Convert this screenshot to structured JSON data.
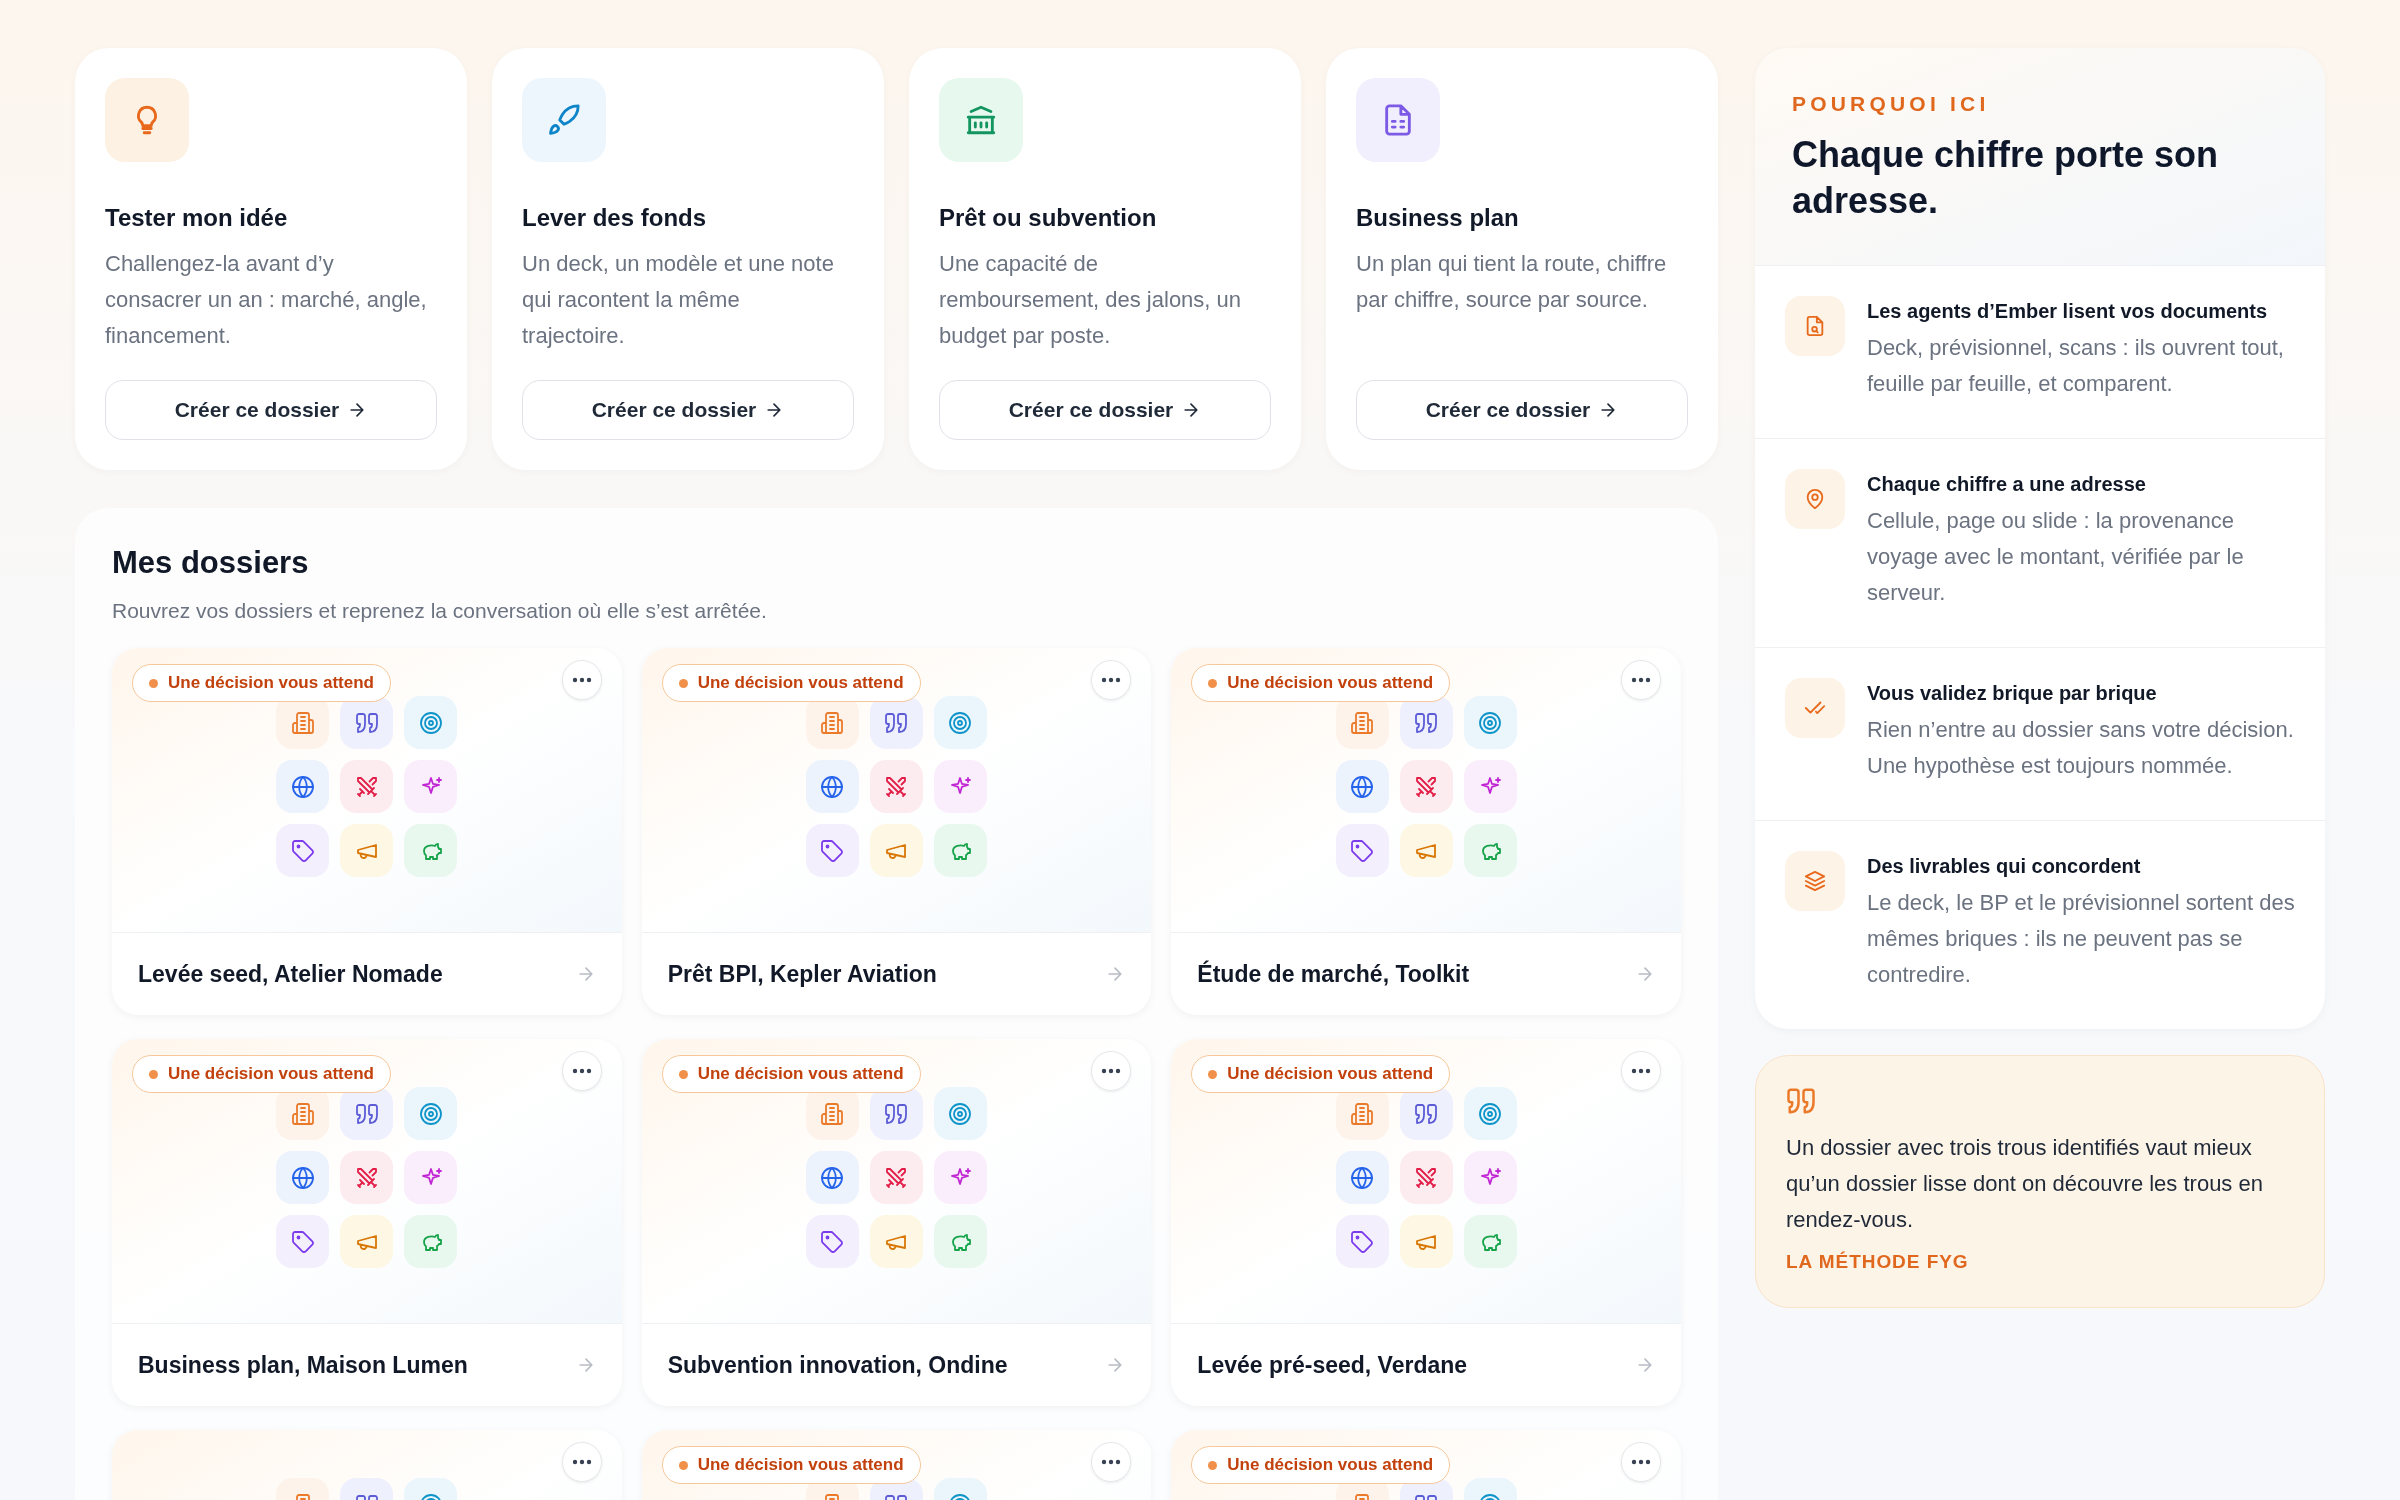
{
  "templates": [
    {
      "title": "Tester mon idée",
      "description": "Challengez-la avant d’y consacrer un an : marché, angle, financement.",
      "button": "Créer ce dossier"
    },
    {
      "title": "Lever des fonds",
      "description": "Un deck, un modèle et une note qui racontent la même trajectoire.",
      "button": "Créer ce dossier"
    },
    {
      "title": "Prêt ou subvention",
      "description": "Une capacité de remboursement, des jalons, un budget par poste.",
      "button": "Créer ce dossier"
    },
    {
      "title": "Business plan",
      "description": "Un plan qui tient la route, chiffre par chiffre, source par source.",
      "button": "Créer ce dossier"
    }
  ],
  "dossiers": {
    "title": "Mes dossiers",
    "subtitle": "Rouvrez vos dossiers et reprenez la conversation où elle s’est arrêtée.",
    "items": [
      {
        "pending": true,
        "badge": "Une décision vous attend",
        "title": "Levée seed, Atelier Nomade"
      },
      {
        "pending": true,
        "badge": "Une décision vous attend",
        "title": "Prêt BPI, Kepler Aviation"
      },
      {
        "pending": true,
        "badge": "Une décision vous attend",
        "title": "Étude de marché, Toolkit"
      },
      {
        "pending": true,
        "badge": "Une décision vous attend",
        "title": "Business plan, Maison Lumen"
      },
      {
        "pending": true,
        "badge": "Une décision vous attend",
        "title": "Subvention innovation, Ondine"
      },
      {
        "pending": true,
        "badge": "Une décision vous attend",
        "title": "Levée pré-seed, Verdane"
      },
      {
        "pending": false
      },
      {
        "pending": true,
        "badge": "Une décision vous attend"
      },
      {
        "pending": true,
        "badge": "Une décision vous attend"
      }
    ]
  },
  "why": {
    "eyebrow": "POURQUOI ICI",
    "heading": "Chaque chiffre porte son adresse.",
    "items": [
      {
        "title": "Les agents d’Ember lisent vos documents",
        "text": "Deck, prévisionnel, scans : ils ouvrent tout, feuille par feuille, et comparent."
      },
      {
        "title": "Chaque chiffre a une adresse",
        "text": "Cellule, page ou slide : la provenance voyage avec le montant, vérifiée par le serveur."
      },
      {
        "title": "Vous validez brique par brique",
        "text": "Rien n’entre au dossier sans votre décision. Une hypothèse est toujours nommée."
      },
      {
        "title": "Des livrables qui concordent",
        "text": "Le deck, le BP et le prévisionnel sortent des mêmes briques : ils ne peuvent pas se contredire."
      }
    ]
  },
  "quote": {
    "text": "Un dossier avec trois trous identifiés vaut mieux qu’un dossier lisse dont on découvre les trous en rendez-vous.",
    "source": "LA MÉTHODE FYG"
  }
}
